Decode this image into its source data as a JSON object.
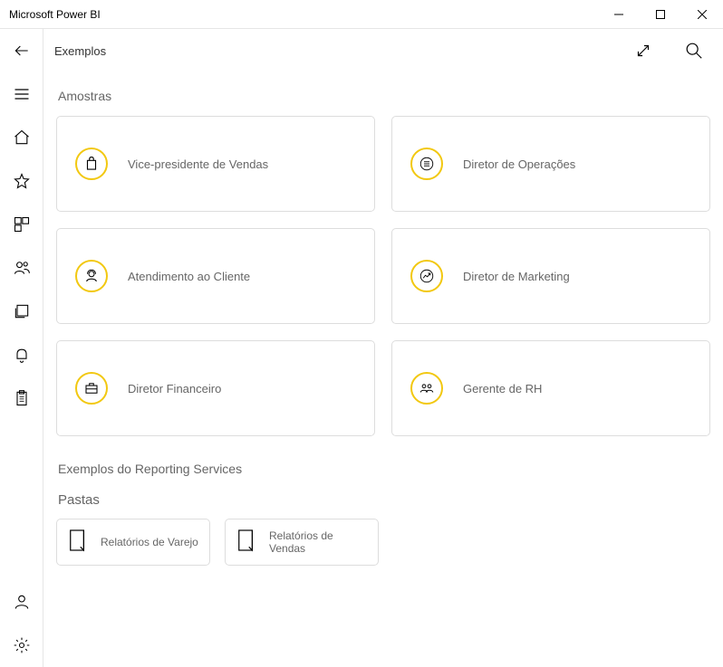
{
  "window": {
    "title": "Microsoft Power BI"
  },
  "header": {
    "title": "Exemplos"
  },
  "sections": {
    "samples_title": "Amostras",
    "rs_title": "Exemplos do Reporting Services",
    "folders_title": "Pastas"
  },
  "samples": [
    {
      "label": "Vice-presidente de Vendas",
      "icon": "shopping-bag"
    },
    {
      "label": "Diretor de Operações",
      "icon": "list"
    },
    {
      "label": "Atendimento ao Cliente",
      "icon": "headset"
    },
    {
      "label": "Diretor de Marketing",
      "icon": "chart-up"
    },
    {
      "label": "Diretor Financeiro",
      "icon": "briefcase"
    },
    {
      "label": "Gerente de RH",
      "icon": "people"
    }
  ],
  "folders": [
    {
      "label": "Relatórios de Varejo"
    },
    {
      "label": "Relatórios de Vendas"
    }
  ]
}
